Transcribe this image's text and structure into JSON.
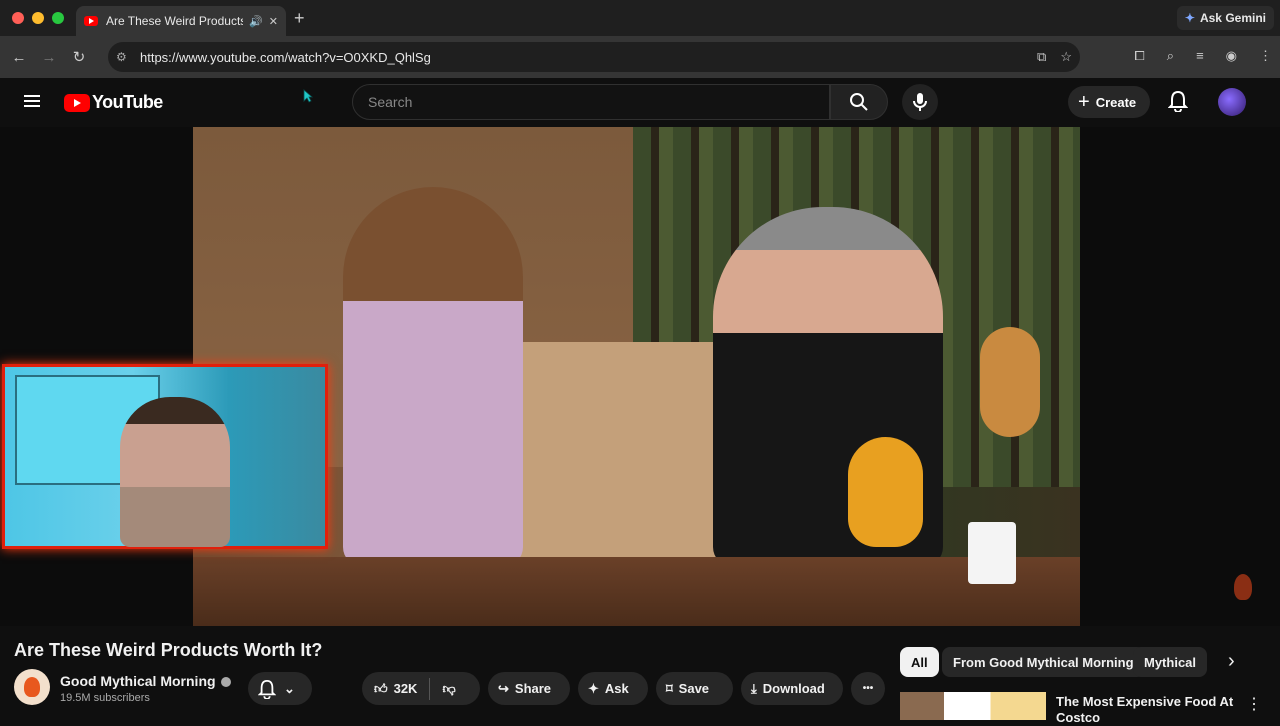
{
  "browser": {
    "tab_title": "Are These Weird Products",
    "new_tab": "+",
    "gemini_label": "Ask Gemini",
    "url": "https://www.youtube.com/watch?v=O0XKD_QhlSg"
  },
  "youtube": {
    "logo_text": "YouTube",
    "search_placeholder": "Search",
    "create_label": "Create"
  },
  "video": {
    "title": "Are These Weird Products Worth It?",
    "channel": "Good Mythical Morning",
    "subscribers": "19.5M subscribers",
    "likes": "32K",
    "share_label": "Share",
    "ask_label": "Ask",
    "save_label": "Save",
    "download_label": "Download",
    "more_label": "•••"
  },
  "chips": [
    "All",
    "From Good Mythical Morning",
    "Mythical"
  ],
  "recommendation": {
    "title": "The Most Expensive Food At Costco"
  },
  "colors": {
    "youtube_red": "#ff0000",
    "background": "#0f0f0f",
    "cam_border": "#e0200c"
  }
}
